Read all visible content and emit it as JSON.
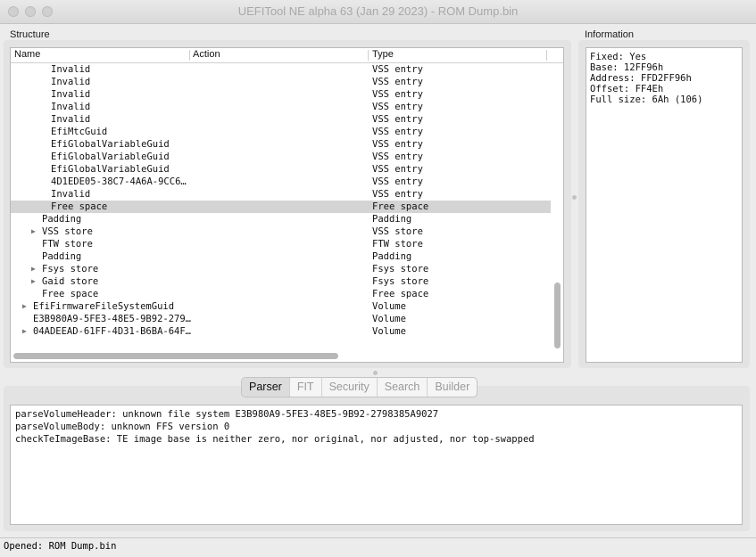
{
  "window": {
    "title": "UEFITool NE alpha 63 (Jan 29 2023) - ROM Dump.bin"
  },
  "structure": {
    "caption": "Structure",
    "columns": {
      "name": "Name",
      "action": "Action",
      "type": "Type"
    },
    "rows": [
      {
        "name": "Invalid",
        "type": "VSS entry",
        "depth": 3,
        "expandable": false,
        "selected": false
      },
      {
        "name": "Invalid",
        "type": "VSS entry",
        "depth": 3,
        "expandable": false,
        "selected": false
      },
      {
        "name": "Invalid",
        "type": "VSS entry",
        "depth": 3,
        "expandable": false,
        "selected": false
      },
      {
        "name": "Invalid",
        "type": "VSS entry",
        "depth": 3,
        "expandable": false,
        "selected": false
      },
      {
        "name": "Invalid",
        "type": "VSS entry",
        "depth": 3,
        "expandable": false,
        "selected": false
      },
      {
        "name": "EfiMtcGuid",
        "type": "VSS entry",
        "depth": 3,
        "expandable": false,
        "selected": false
      },
      {
        "name": "EfiGlobalVariableGuid",
        "type": "VSS entry",
        "depth": 3,
        "expandable": false,
        "selected": false
      },
      {
        "name": "EfiGlobalVariableGuid",
        "type": "VSS entry",
        "depth": 3,
        "expandable": false,
        "selected": false
      },
      {
        "name": "EfiGlobalVariableGuid",
        "type": "VSS entry",
        "depth": 3,
        "expandable": false,
        "selected": false
      },
      {
        "name": "4D1EDE05-38C7-4A6A-9CC6…",
        "type": "VSS entry",
        "depth": 3,
        "expandable": false,
        "selected": false
      },
      {
        "name": "Invalid",
        "type": "VSS entry",
        "depth": 3,
        "expandable": false,
        "selected": false
      },
      {
        "name": "Free space",
        "type": "Free space",
        "depth": 3,
        "expandable": false,
        "selected": true
      },
      {
        "name": "Padding",
        "type": "Padding",
        "depth": 2,
        "expandable": false,
        "selected": false
      },
      {
        "name": "VSS store",
        "type": "VSS store",
        "depth": 2,
        "expandable": true,
        "selected": false
      },
      {
        "name": "FTW store",
        "type": "FTW store",
        "depth": 2,
        "expandable": false,
        "selected": false
      },
      {
        "name": "Padding",
        "type": "Padding",
        "depth": 2,
        "expandable": false,
        "selected": false
      },
      {
        "name": "Fsys store",
        "type": "Fsys store",
        "depth": 2,
        "expandable": true,
        "selected": false
      },
      {
        "name": "Gaid store",
        "type": "Fsys store",
        "depth": 2,
        "expandable": true,
        "selected": false
      },
      {
        "name": "Free space",
        "type": "Free space",
        "depth": 2,
        "expandable": false,
        "selected": false
      },
      {
        "name": "EfiFirmwareFileSystemGuid",
        "type": "Volume",
        "depth": 1,
        "expandable": true,
        "selected": false
      },
      {
        "name": "E3B980A9-5FE3-48E5-9B92-279…",
        "type": "Volume",
        "depth": 1,
        "expandable": false,
        "selected": false
      },
      {
        "name": "04ADEEAD-61FF-4D31-B6BA-64F…",
        "type": "Volume",
        "depth": 1,
        "expandable": true,
        "selected": false
      }
    ]
  },
  "information": {
    "caption": "Information",
    "lines": [
      "Fixed: Yes",
      "Base: 12FF96h",
      "Address: FFD2FF96h",
      "Offset: FF4Eh",
      "Full size: 6Ah (106)"
    ]
  },
  "tabs": [
    {
      "label": "Parser",
      "active": true
    },
    {
      "label": "FIT",
      "active": false
    },
    {
      "label": "Security",
      "active": false
    },
    {
      "label": "Search",
      "active": false
    },
    {
      "label": "Builder",
      "active": false
    }
  ],
  "messages": [
    "parseVolumeHeader: unknown file system E3B980A9-5FE3-48E5-9B92-2798385A9027",
    "parseVolumeBody: unknown FFS version 0",
    "checkTeImageBase: TE image base is neither zero, nor original, nor adjusted, nor top-swapped"
  ],
  "status": {
    "text": "Opened: ROM Dump.bin"
  },
  "icons": {
    "expand": "triangle-right-icon"
  }
}
